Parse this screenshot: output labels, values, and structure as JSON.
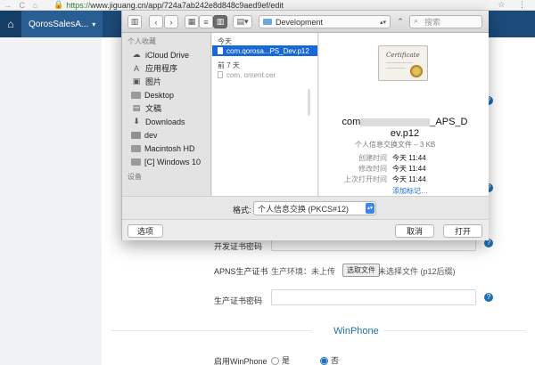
{
  "browser": {
    "url_scheme": "https://",
    "url_host": "www.jiguang.cn",
    "url_path": "/app/724a7ab242e8d848c9aed9ef/edit"
  },
  "app": {
    "tab_label": "QorosSalesA..."
  },
  "form": {
    "dev_cert_password_label": "开发证书密码",
    "prod_cert_label": "APNS生产证书",
    "prod_env_label": "生产环境：未上传",
    "choose_file_button": "选取文件",
    "no_file_text": "未选择文件 (p12后缀)",
    "prod_password_label": "生产证书密码",
    "winphone_title": "WinPhone",
    "winphone_enable_label": "启用WinPhone",
    "radio_yes": "是",
    "radio_no": "否"
  },
  "dialog": {
    "path_folder": "Development",
    "search_placeholder": "搜索",
    "sidebar": {
      "favorites_header": "个人收藏",
      "devices_header": "设备",
      "items": [
        {
          "label": "iCloud Drive",
          "icon": "cloud-icon"
        },
        {
          "label": "应用程序",
          "icon": "applications-icon"
        },
        {
          "label": "图片",
          "icon": "pictures-icon"
        },
        {
          "label": "Desktop",
          "icon": "desktop-icon"
        },
        {
          "label": "文稿",
          "icon": "documents-icon"
        },
        {
          "label": "Downloads",
          "icon": "downloads-icon"
        },
        {
          "label": "dev",
          "icon": "folder-icon"
        },
        {
          "label": "Macintosh HD",
          "icon": "disk-icon"
        },
        {
          "label": "[C] Windows 10",
          "icon": "disk-icon"
        }
      ]
    },
    "list": {
      "today_header": "今天",
      "week_header": "前 7 天",
      "today_file": "com.qorosa...PS_Dev.p12",
      "week_file": "com.            oment.cer"
    },
    "preview": {
      "name_line1_start": "com",
      "name_line1_end": "_APS_D",
      "name_line2": "ev.p12",
      "subtitle": "个人信息交换文件 – 3 KB",
      "created_label": "创建时间",
      "created_value": "今天 11:44",
      "modified_label": "修改时间",
      "modified_value": "今天 11:44",
      "opened_label": "上次打开时间",
      "opened_value": "今天 11:44",
      "add_tags": "添加标记…"
    },
    "format_label": "格式:",
    "format_value": "个人信息交换 (PKCS#12)",
    "options_button": "选项",
    "cancel_button": "取消",
    "open_button": "打开"
  }
}
